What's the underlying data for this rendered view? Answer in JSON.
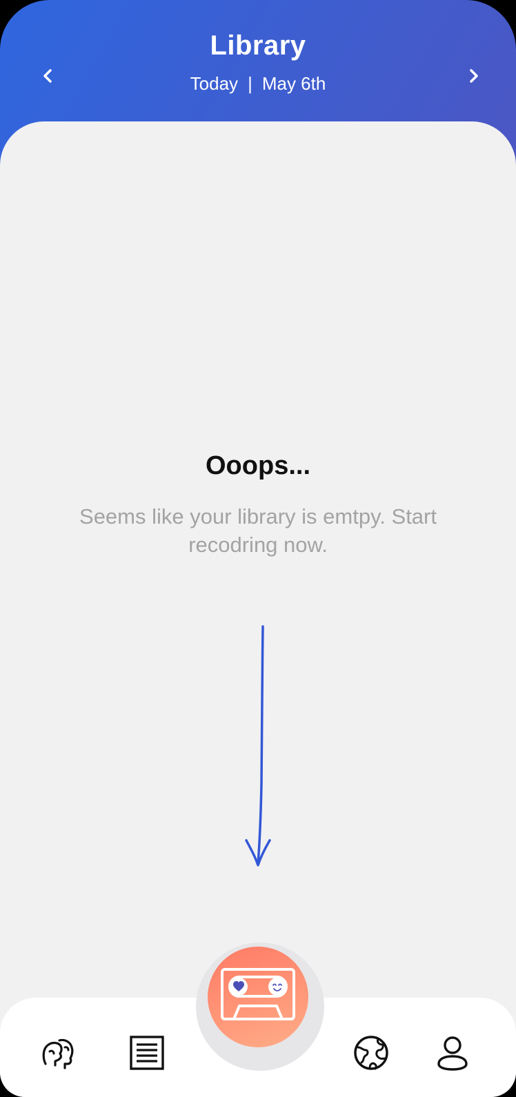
{
  "header": {
    "title": "Library",
    "day_label": "Today",
    "separator": "|",
    "date_label": "May 6th"
  },
  "empty_state": {
    "title": "Ooops...",
    "message": "Seems like your library is emtpy. Start recodring now."
  },
  "colors": {
    "header_gradient_start": "#2f66df",
    "header_gradient_end": "#5c4ea8",
    "content_bg": "#f1f1f2",
    "arrow_blue": "#3357d6",
    "record_gradient_start": "#ff7a64",
    "record_gradient_end": "#ffad88"
  },
  "icons": {
    "prev": "chevron-left-icon",
    "next": "chevron-right-icon",
    "discover": "people-heads-icon",
    "list": "list-document-icon",
    "record": "cassette-tape-icon",
    "globe": "globe-icon",
    "profile": "user-icon"
  }
}
